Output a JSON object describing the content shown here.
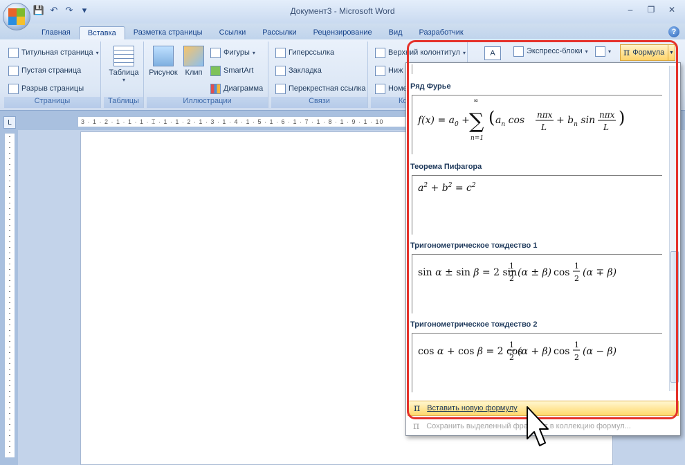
{
  "window": {
    "title": "Документ3 - Microsoft Word",
    "controls": [
      "–",
      "❐",
      "✕"
    ]
  },
  "qat": {
    "save": "💾",
    "undo": "↶",
    "redo": "↷",
    "customize": "▾"
  },
  "tabs": [
    "Главная",
    "Вставка",
    "Разметка страницы",
    "Ссылки",
    "Рассылки",
    "Рецензирование",
    "Вид",
    "Разработчик"
  ],
  "help": "?",
  "ribbon": {
    "pages": {
      "label": "Страницы",
      "items": [
        "Титульная страница",
        "Пустая страница",
        "Разрыв страницы"
      ]
    },
    "tables": {
      "label": "Таблицы",
      "table": "Таблица"
    },
    "illustrations": {
      "label": "Иллюстрации",
      "picture": "Рисунок",
      "clip": "Клип",
      "shapes": "Фигуры",
      "smartart": "SmartArt",
      "chart": "Диаграмма"
    },
    "links": {
      "label": "Связи",
      "hyperlink": "Гиперссылка",
      "bookmark": "Закладка",
      "crossref": "Перекрестная ссылка"
    },
    "header_footer": {
      "label": "Ко",
      "header": "Верхний колонтитул",
      "footer": "Ниж",
      "page_number": "Номе"
    },
    "text": {
      "quick_parts": "Экспресс-блоки",
      "textbox_glyph": "A"
    },
    "formula": {
      "label": "Формула",
      "glyph": "π"
    }
  },
  "ruler": {
    "corner": "L",
    "marks": "3 · 1 · 2 · 1 · 1 · 1 · ⌶ · 1 · 1 · 2 · 1 · 3 · 1 · 4 · 1 · 5 · 1 · 6 · 1 · 7 · 1 · 8 · 1 · 9 · 1 · 10"
  },
  "gallery": {
    "sections": [
      {
        "title": "Ряд Фурье",
        "formula": "f(x) = a₀ + ∑ₙ₌₁^∞ (aₙ cos nπx/L + bₙ sin nπx/L)"
      },
      {
        "title": "Теорема Пифагора",
        "formula": "a² + b² = c²"
      },
      {
        "title": "Тригонометрическое тождество 1",
        "formula": "sin α ± sin β = 2 sin ½(α ± β) cos ½(α ∓ β)"
      },
      {
        "title": "Тригонометрическое тождество 2",
        "formula": "cos α + cos β = 2 cos ½(α + β) cos ½(α − β)"
      }
    ],
    "insert_new": "Вставить новую формулу",
    "save_selection": "Сохранить выделенный фрагмент в коллекцию формул...",
    "pi_glyph": "π"
  },
  "colors": {
    "accent_red": "#e5322b",
    "highlight": "#ffd86b",
    "ribbon_bg": "#dce7f5",
    "tab_text": "#15428b"
  }
}
